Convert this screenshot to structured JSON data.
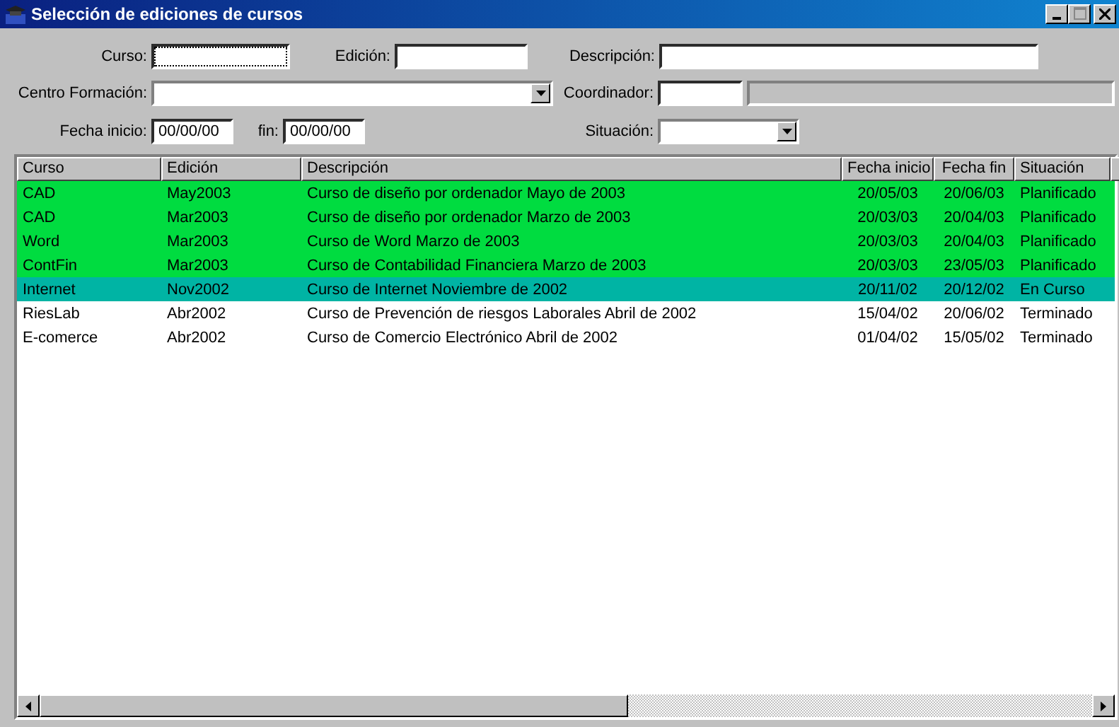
{
  "window": {
    "title": "Selección de ediciones de cursos"
  },
  "filters": {
    "curso": {
      "label": "Curso:"
    },
    "edicion": {
      "label": "Edición:"
    },
    "descripcion": {
      "label": "Descripción:"
    },
    "centro": {
      "label": "Centro Formación:"
    },
    "coordinador": {
      "label": "Coordinador:"
    },
    "fecha_inicio": {
      "label": "Fecha inicio:",
      "value": "00/00/00"
    },
    "fecha_fin": {
      "label": "fin:",
      "value": "00/00/00"
    },
    "situacion": {
      "label": "Situación:"
    }
  },
  "table": {
    "columns": [
      "Curso",
      "Edición",
      "Descripción",
      "Fecha inicio",
      "Fecha fin",
      "Situación"
    ],
    "rows": [
      {
        "cells": [
          "CAD",
          "May2003",
          "Curso de diseño por ordenador Mayo de 2003",
          "20/05/03",
          "20/06/03",
          "Planificado"
        ],
        "color": "#00dc40"
      },
      {
        "cells": [
          "CAD",
          "Mar2003",
          "Curso de diseño por ordenador Marzo de 2003",
          "20/03/03",
          "20/04/03",
          "Planificado"
        ],
        "color": "#00dc40"
      },
      {
        "cells": [
          "Word",
          "Mar2003",
          "Curso de Word Marzo de 2003",
          "20/03/03",
          "20/04/03",
          "Planificado"
        ],
        "color": "#00dc40"
      },
      {
        "cells": [
          "ContFin",
          "Mar2003",
          "Curso de Contabilidad Financiera Marzo de 2003",
          "20/03/03",
          "23/05/03",
          "Planificado"
        ],
        "color": "#00dc40"
      },
      {
        "cells": [
          "Internet",
          "Nov2002",
          "Curso de Internet Noviembre de 2002",
          "20/11/02",
          "20/12/02",
          "En Curso"
        ],
        "color": "#00b4a4"
      },
      {
        "cells": [
          "RiesLab",
          "Abr2002",
          "Curso de Prevención de riesgos Laborales Abril de 2002",
          "15/04/02",
          "20/06/02",
          "Terminado"
        ],
        "color": "#ffffff"
      },
      {
        "cells": [
          "E-comerce",
          "Abr2002",
          "Curso de Comercio Electrónico Abril de 2002",
          "01/04/02",
          "15/05/02",
          "Terminado"
        ],
        "color": "#ffffff"
      }
    ]
  }
}
